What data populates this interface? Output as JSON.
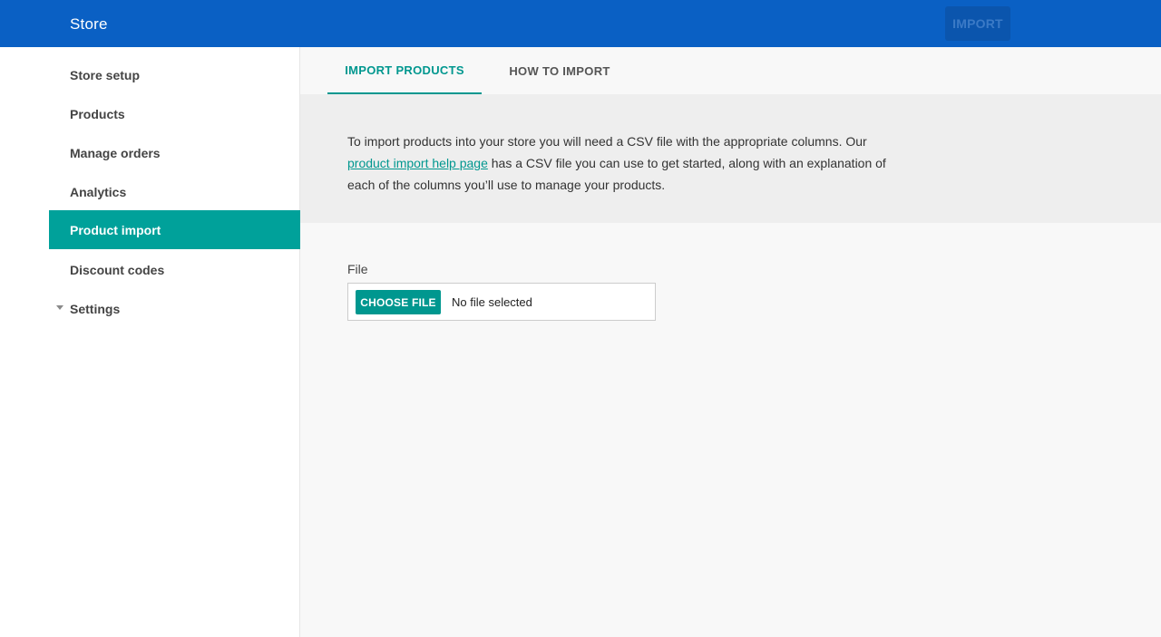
{
  "header": {
    "title": "Store",
    "import_label": "IMPORT"
  },
  "sidebar": {
    "items": [
      {
        "label": "Store setup"
      },
      {
        "label": "Products"
      },
      {
        "label": "Manage orders"
      },
      {
        "label": "Analytics"
      },
      {
        "label": "Product import",
        "active": true
      },
      {
        "label": "Discount codes"
      },
      {
        "label": "Settings",
        "expandable": true
      }
    ]
  },
  "tabs": [
    {
      "label": "IMPORT PRODUCTS",
      "active": true
    },
    {
      "label": "HOW TO IMPORT"
    }
  ],
  "info": {
    "text_before": "To import products into your store you will need a CSV file with the appropriate columns. Our ",
    "link_text": "product import help page",
    "text_after": " has a CSV file you can use to get started, along with an explanation of each of the columns you’ll use to manage your products."
  },
  "file": {
    "label": "File",
    "button_label": "CHOOSE FILE",
    "status": "No file selected"
  },
  "colors": {
    "header_blue": "#0a60c4",
    "accent_teal": "#00a19a"
  },
  "icons": {
    "settings_caret": "caret-down-icon"
  }
}
